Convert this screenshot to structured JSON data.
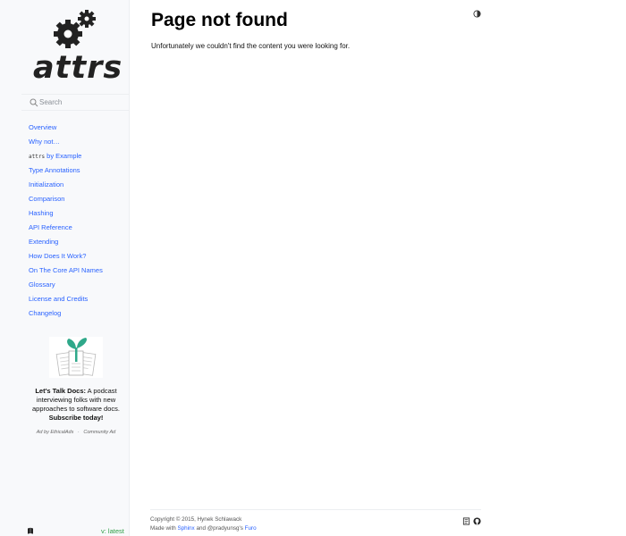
{
  "logo": {
    "text": "attrs"
  },
  "search": {
    "placeholder": "Search"
  },
  "nav": {
    "items": [
      "Overview",
      "Why not…",
      {
        "code": "attrs",
        "label": " by Example"
      },
      "Type Annotations",
      "Initialization",
      "Comparison",
      "Hashing",
      "API Reference",
      "Extending",
      "How Does It Work?",
      "On The Core API Names",
      "Glossary",
      "License and Credits",
      "Changelog"
    ]
  },
  "ad": {
    "title_bold": "Let's Talk Docs:",
    "title_rest": " A podcast interviewing folks with new approaches to software docs.",
    "cta": "Subscribe today!",
    "meta_left": "Ad by EthicalAds",
    "meta_sep": "·",
    "meta_right": "Community Ad"
  },
  "sidebar_footer": {
    "version": "v: latest"
  },
  "page": {
    "title": "Page not found",
    "description": "Unfortunately we couldn't find the content you were looking for."
  },
  "footer": {
    "copyright": "Copyright © 2015, Hynek Schlawack",
    "made_with": "Made with ",
    "sphinx": "Sphinx",
    "and": " and @pradyunsg's ",
    "furo": "Furo"
  },
  "colors": {
    "link": "#2962ff",
    "version": "#2e9e46",
    "sidebar_bg": "#f8f9fb"
  },
  "icons": [
    "gears-logo-icon",
    "search-icon",
    "podcast-plant-icon",
    "book-icon",
    "theme-toggle-icon",
    "github-icon"
  ]
}
